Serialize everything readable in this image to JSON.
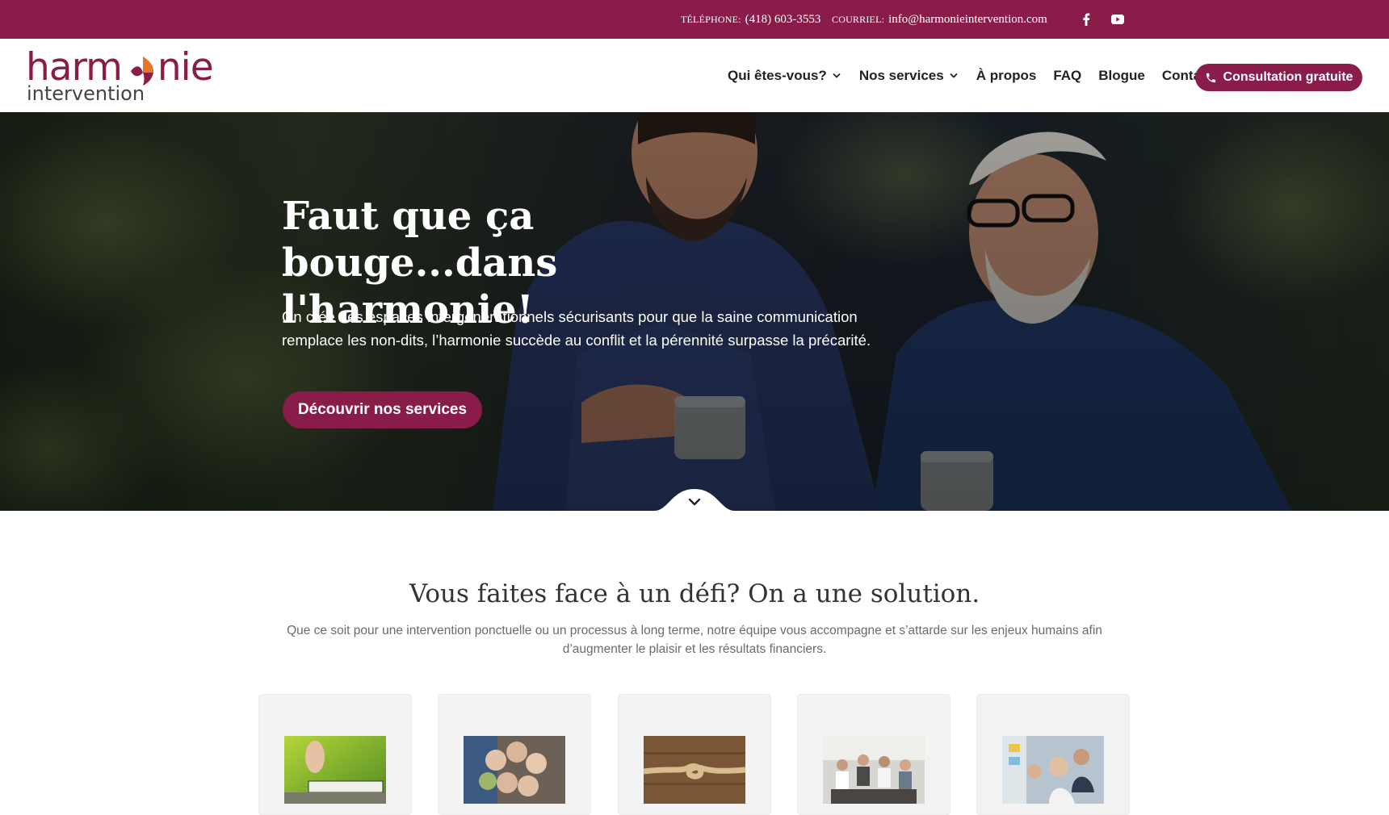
{
  "topbar": {
    "phone_label": "TÉLÉPHONE:",
    "phone_value": "(418) 603-3553",
    "email_label": "COURRIEL:",
    "email_value": "info@harmonieintervention.com",
    "social": [
      {
        "icon": "facebook-icon"
      },
      {
        "icon": "youtube-icon"
      }
    ]
  },
  "logo": {
    "line1": "harmonie",
    "line2": "intervention"
  },
  "nav": {
    "items": [
      {
        "label": "Qui êtes-vous?",
        "has_dropdown": true
      },
      {
        "label": "Nos services",
        "has_dropdown": true
      },
      {
        "label": "À propos",
        "has_dropdown": false
      },
      {
        "label": "FAQ",
        "has_dropdown": false
      },
      {
        "label": "Blogue",
        "has_dropdown": false
      },
      {
        "label": "Contact",
        "has_dropdown": false
      }
    ],
    "cta_label": "Consultation gratuite",
    "cta_icon": "phone-icon"
  },
  "hero": {
    "title": "Faut que ça bouge...dans l'harmonie!",
    "subtitle": "On crée des espaces intergénérationnels sécurisants pour que la saine communication remplace les non-dits, l’harmonie succède au conflit et la pérennité surpasse la précarité.",
    "button_label": "Découvrir nos services",
    "scroll_icon": "chevron-down-icon"
  },
  "solutions": {
    "title": "Vous faites face à un défi? On a une solution.",
    "subtitle": "Que ce soit pour une intervention ponctuelle ou un processus à long terme, notre équipe vous accompagne et s’attarde sur les enjeux humains afin d’augmenter le plaisir et les résultats financiers.",
    "cards": [
      {
        "image": "senior-blocks-photo"
      },
      {
        "image": "group-circle-photo"
      },
      {
        "image": "rope-knot-photo"
      },
      {
        "image": "team-meeting-photo"
      },
      {
        "image": "office-team-photo"
      }
    ]
  },
  "colors": {
    "brand": "#8a1c49",
    "accent_orange": "#e8742a",
    "text_dark": "#222222",
    "text_muted": "#6b6b6b"
  }
}
